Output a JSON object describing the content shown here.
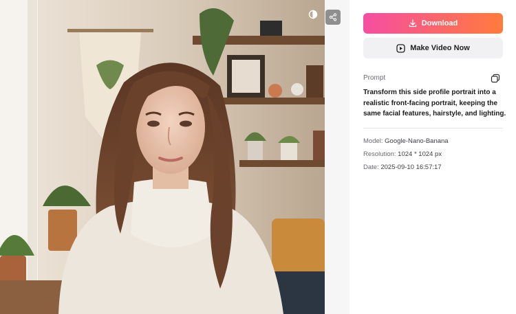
{
  "toolbar": {
    "compare_icon": "half-circle-compare-icon",
    "share_icon": "share-nodes-icon"
  },
  "actions": {
    "download_label": "Download",
    "download_icon": "download-icon",
    "video_label": "Make Video Now",
    "video_icon": "play-square-icon"
  },
  "prompt": {
    "label": "Prompt",
    "copy_icon": "copy-icon",
    "text": "Transform this side profile portrait into a realistic front-facing portrait, keeping the same facial features, hairstyle, and lighting."
  },
  "details": {
    "model_label": "Model:",
    "model_value": "Google-Nano-Banana",
    "resolution_label": "Resolution:",
    "resolution_value": "1024 * 1024 px",
    "date_label": "Date:",
    "date_value": "2025-09-10 16:57:17"
  },
  "colors": {
    "download_gradient_start": "#f54ea2",
    "download_gradient_end": "#ff7b3c",
    "secondary_button_bg": "#f1f1f4"
  }
}
